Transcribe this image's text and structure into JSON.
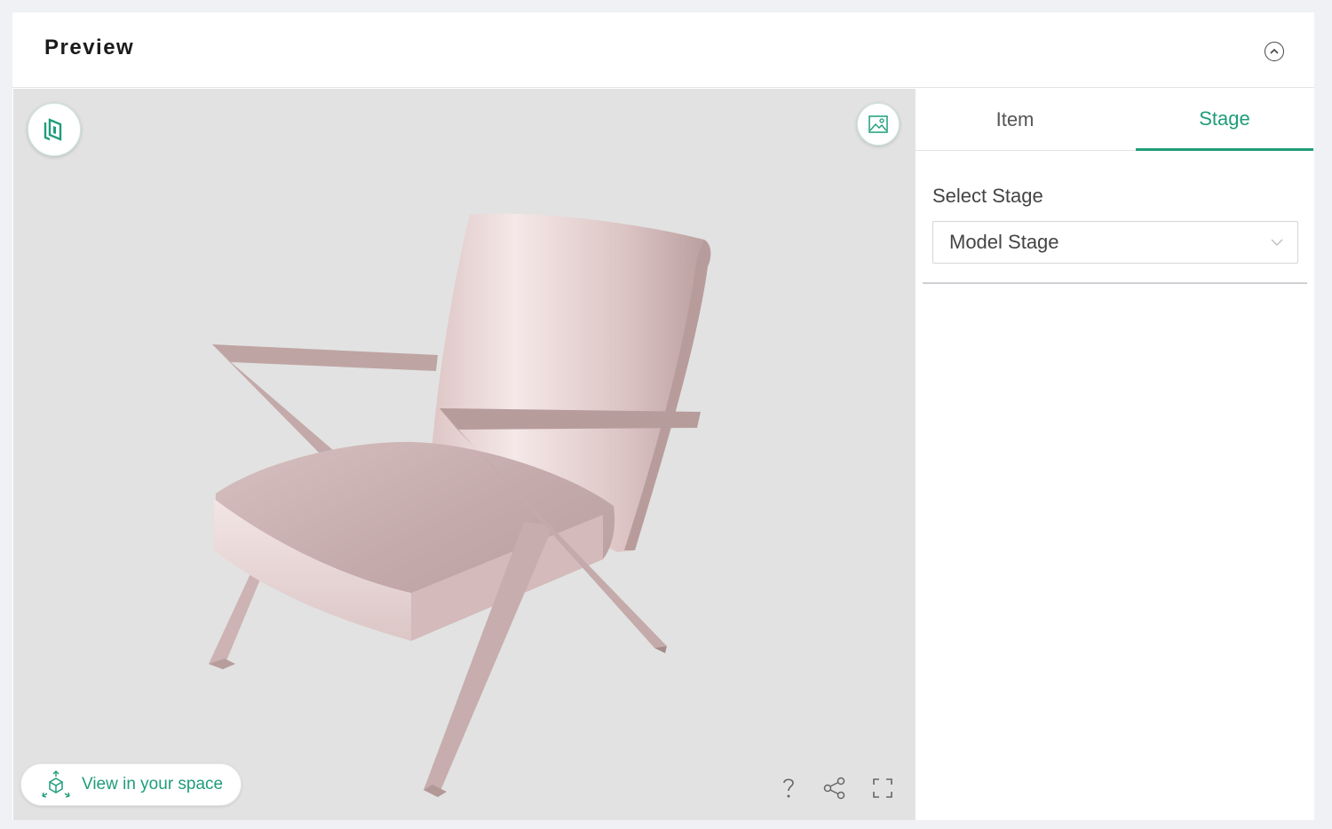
{
  "header": {
    "title": "Preview"
  },
  "viewer": {
    "ar_button_label": "View in your space"
  },
  "panel": {
    "tabs": [
      {
        "label": "Item",
        "active": false
      },
      {
        "label": "Stage",
        "active": true
      }
    ],
    "select_stage_label": "Select Stage",
    "select_stage_value": "Model Stage"
  },
  "colors": {
    "accent": "#1f9d7a",
    "viewer_background": "#e2e2e2",
    "chair": "#d9c0c0"
  },
  "icons": {
    "collapse": "chevron-up-circle-icon",
    "logo": "brand-logo-icon",
    "background": "image-icon",
    "ar": "ar-cube-icon",
    "help": "question-icon",
    "share": "share-icon",
    "fullscreen": "fullscreen-icon",
    "dropdown": "chevron-down-icon"
  }
}
